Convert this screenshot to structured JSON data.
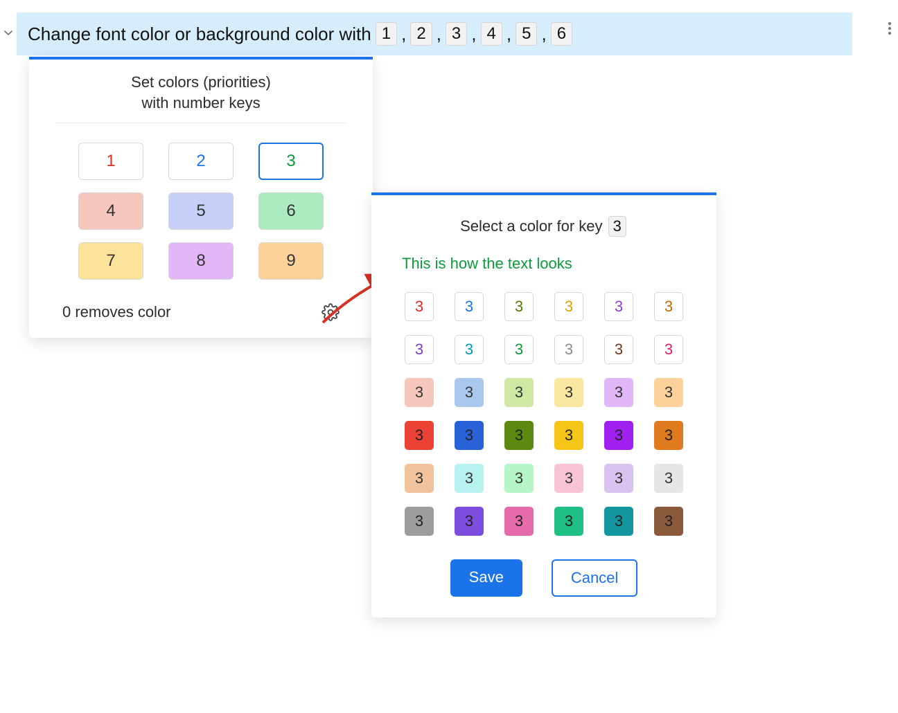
{
  "header": {
    "text_before": "Change font color or background color with",
    "keys": [
      "1",
      "2",
      "3",
      "4",
      "5",
      "6"
    ]
  },
  "panel1": {
    "title_line1": "Set colors (priorities)",
    "title_line2": "with number keys",
    "cells": [
      {
        "label": "1",
        "bg": "#ffffff",
        "fg": "#d93025",
        "selected": false
      },
      {
        "label": "2",
        "bg": "#ffffff",
        "fg": "#1a73e8",
        "selected": false
      },
      {
        "label": "3",
        "bg": "#ffffff",
        "fg": "#0c9a3b",
        "selected": true
      },
      {
        "label": "4",
        "bg": "#f6c7bd",
        "fg": "#333333",
        "selected": false
      },
      {
        "label": "5",
        "bg": "#c6cff6",
        "fg": "#333333",
        "selected": false
      },
      {
        "label": "6",
        "bg": "#aceabf",
        "fg": "#333333",
        "selected": false
      },
      {
        "label": "7",
        "bg": "#fce39a",
        "fg": "#333333",
        "selected": false
      },
      {
        "label": "8",
        "bg": "#e2b7f7",
        "fg": "#333333",
        "selected": false
      },
      {
        "label": "9",
        "bg": "#fcd29a",
        "fg": "#333333",
        "selected": false
      }
    ],
    "footer_text": "0 removes color"
  },
  "panel2": {
    "title_prefix": "Select a color for key",
    "title_key": "3",
    "preview_text": "This is how the text looks",
    "preview_fg": "#0c9a3b",
    "swatch_label": "3",
    "swatches": [
      {
        "bg": "#ffffff",
        "fg": "#d93025"
      },
      {
        "bg": "#ffffff",
        "fg": "#1a73e8"
      },
      {
        "bg": "#ffffff",
        "fg": "#4f7d00"
      },
      {
        "bg": "#ffffff",
        "fg": "#d9a400"
      },
      {
        "bg": "#ffffff",
        "fg": "#8d3dd3"
      },
      {
        "bg": "#ffffff",
        "fg": "#c36b00"
      },
      {
        "bg": "#ffffff",
        "fg": "#7b3fbf"
      },
      {
        "bg": "#ffffff",
        "fg": "#0099b8"
      },
      {
        "bg": "#ffffff",
        "fg": "#0c9a3b"
      },
      {
        "bg": "#ffffff",
        "fg": "#8a8a8a"
      },
      {
        "bg": "#ffffff",
        "fg": "#6b3a1f"
      },
      {
        "bg": "#ffffff",
        "fg": "#e91e63"
      },
      {
        "bg": "#f6c7bd",
        "fg": "#333333"
      },
      {
        "bg": "#aac7ee",
        "fg": "#333333"
      },
      {
        "bg": "#cfe8a3",
        "fg": "#333333"
      },
      {
        "bg": "#fbe8a0",
        "fg": "#333333"
      },
      {
        "bg": "#e2b7f7",
        "fg": "#333333"
      },
      {
        "bg": "#fcd29a",
        "fg": "#333333"
      },
      {
        "bg": "#ea4335",
        "fg": "#222222"
      },
      {
        "bg": "#2962d6",
        "fg": "#222222"
      },
      {
        "bg": "#5c8a11",
        "fg": "#222222"
      },
      {
        "bg": "#f5c518",
        "fg": "#222222"
      },
      {
        "bg": "#a020f0",
        "fg": "#222222"
      },
      {
        "bg": "#e07a1f",
        "fg": "#222222"
      },
      {
        "bg": "#f1c29b",
        "fg": "#333333"
      },
      {
        "bg": "#b8f2f0",
        "fg": "#333333"
      },
      {
        "bg": "#b6f5c6",
        "fg": "#333333"
      },
      {
        "bg": "#f8c3d6",
        "fg": "#333333"
      },
      {
        "bg": "#d9c2f0",
        "fg": "#333333"
      },
      {
        "bg": "#e6e6e6",
        "fg": "#333333"
      },
      {
        "bg": "#9d9d9d",
        "fg": "#222222"
      },
      {
        "bg": "#7c4dde",
        "fg": "#222222"
      },
      {
        "bg": "#e66baa",
        "fg": "#222222"
      },
      {
        "bg": "#1fbf86",
        "fg": "#222222"
      },
      {
        "bg": "#1496a0",
        "fg": "#222222"
      },
      {
        "bg": "#8b5a3c",
        "fg": "#222222"
      }
    ],
    "save_label": "Save",
    "cancel_label": "Cancel"
  }
}
